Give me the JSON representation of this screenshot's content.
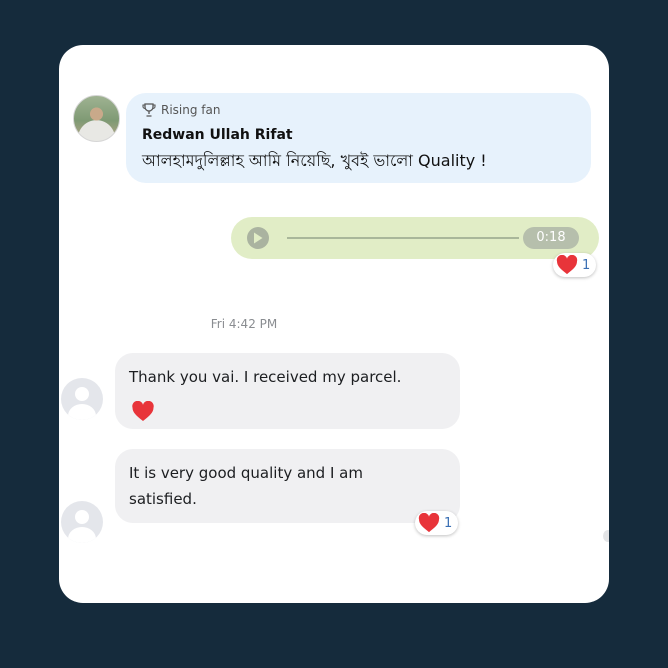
{
  "top_comment": {
    "badge": "Rising fan",
    "badge_icon": "trophy-icon",
    "author": "Redwan Ullah Rifat",
    "text": "আলহামদুলিল্লাহ আমি নিয়েছি, খুবই ভালো Quality !",
    "bubble_color": "#e7f2fc"
  },
  "voice_message": {
    "duration": "0:18",
    "bubble_color": "#e1edc6",
    "reaction": {
      "icon": "heart-icon",
      "count": "1"
    }
  },
  "timestamp": "Fri 4:42 PM",
  "messages": [
    {
      "text": "Thank you vai. I received my parcel.",
      "emoji": "heart"
    },
    {
      "text_line1": "It is very good quality and I am",
      "text_line2": "satisfied.",
      "reaction": {
        "icon": "heart-icon",
        "count": "1"
      }
    }
  ],
  "colors": {
    "background": "#152b3c",
    "heart": "#e8343a",
    "reaction_count": "#3b6fb4"
  }
}
